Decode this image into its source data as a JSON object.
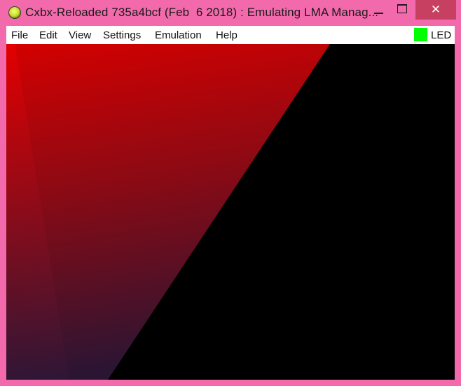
{
  "window": {
    "title": "Cxbx-Reloaded 735a4bcf (Feb  6 2018) : Emulating LMA Manag...",
    "minimize_icon": "minimize-icon",
    "maximize_icon": "maximize-icon",
    "close_icon": "close-icon",
    "close_glyph": "✕"
  },
  "menubar": {
    "items": [
      {
        "label": "File"
      },
      {
        "label": "Edit"
      },
      {
        "label": "View"
      },
      {
        "label": "Settings"
      },
      {
        "label": "Emulation"
      },
      {
        "label": "Help"
      }
    ],
    "led": {
      "label": "LED",
      "color": "#00ff00"
    }
  },
  "render": {
    "background_color": "#000000",
    "triangle_top_color": "#d40000",
    "triangle_bottom_color": "#2a1533"
  }
}
